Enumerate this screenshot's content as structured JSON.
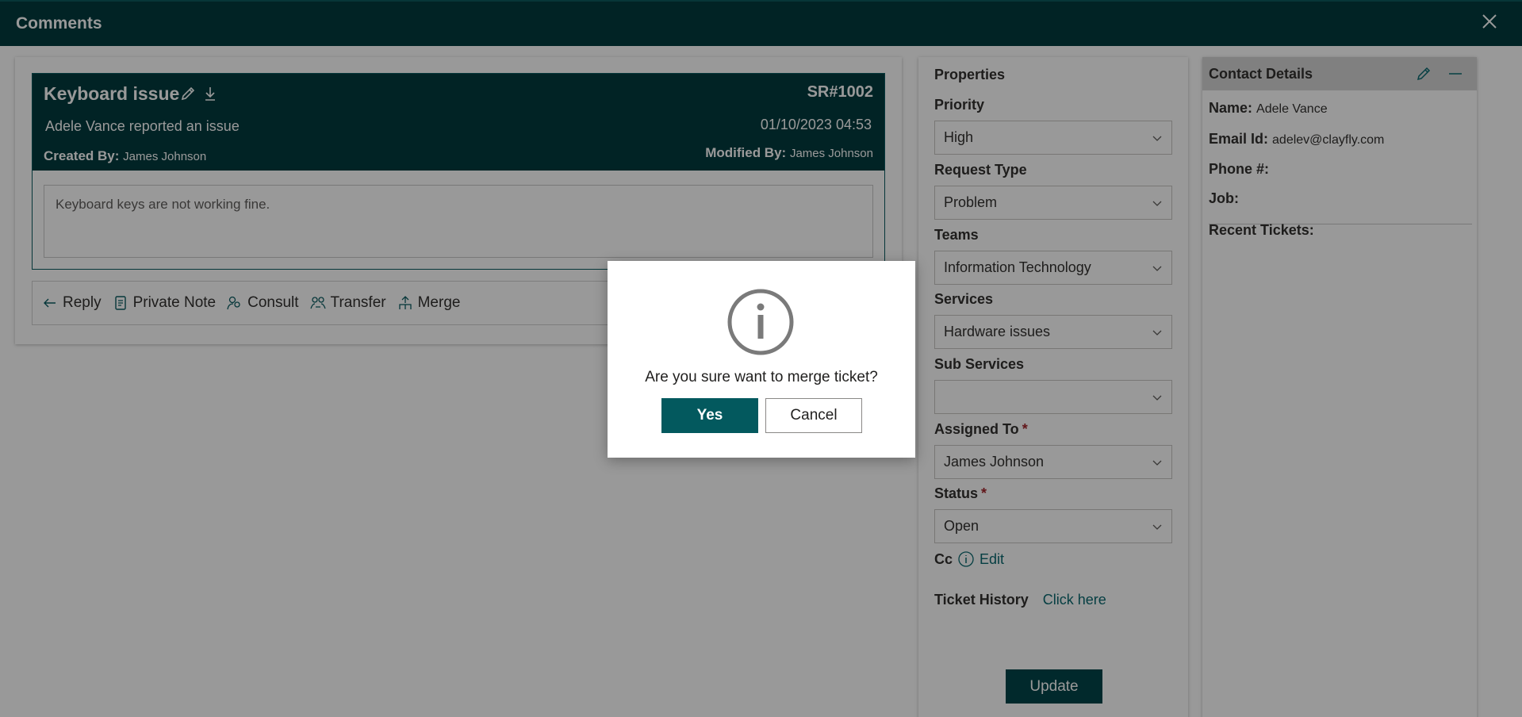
{
  "header": {
    "title": "Comments"
  },
  "ticket": {
    "title": "Keyboard issue",
    "id": "SR#1002",
    "reporter_text": "Adele Vance reported an issue",
    "datetime": "01/10/2023 04:53",
    "created_by_label": "Created By:",
    "created_by": "James Johnson",
    "modified_by_label": "Modified By:",
    "modified_by": "James Johnson",
    "description": "Keyboard keys are not working fine."
  },
  "actions": [
    {
      "label": "Reply",
      "icon": "arrow-left-icon"
    },
    {
      "label": "Private Note",
      "icon": "note-icon"
    },
    {
      "label": "Consult",
      "icon": "people-icon"
    },
    {
      "label": "Transfer",
      "icon": "transfer-icon"
    },
    {
      "label": "Merge",
      "icon": "merge-icon"
    }
  ],
  "properties": {
    "title": "Properties",
    "fields": [
      {
        "label": "Priority",
        "value": "High",
        "required": false
      },
      {
        "label": "Request Type",
        "value": "Problem",
        "required": false
      },
      {
        "label": "Teams",
        "value": "Information Technology",
        "required": false
      },
      {
        "label": "Services",
        "value": "Hardware issues",
        "required": false
      },
      {
        "label": "Sub Services",
        "value": "",
        "required": false
      },
      {
        "label": "Assigned To",
        "value": "James Johnson",
        "required": true
      },
      {
        "label": "Status",
        "value": "Open",
        "required": true
      }
    ],
    "required_marker": "*",
    "cc_label": "Cc",
    "cc_edit": "Edit",
    "history_label": "Ticket History",
    "history_link": "Click here",
    "update_button": "Update"
  },
  "contact": {
    "title": "Contact Details",
    "name_label": "Name:",
    "name": "Adele Vance",
    "email_label": "Email Id:",
    "email": "adelev@clayfly.com",
    "phone_label": "Phone #:",
    "job_label": "Job:",
    "recent_label": "Recent Tickets:"
  },
  "dialog": {
    "icon": "info-icon",
    "message": "Are you sure want to merge ticket?",
    "yes_label": "Yes",
    "cancel_label": "Cancel"
  },
  "colors": {
    "header_bg": "#033b3f",
    "accent": "#03595e",
    "link": "#0b6a70",
    "required": "#a4262c"
  }
}
